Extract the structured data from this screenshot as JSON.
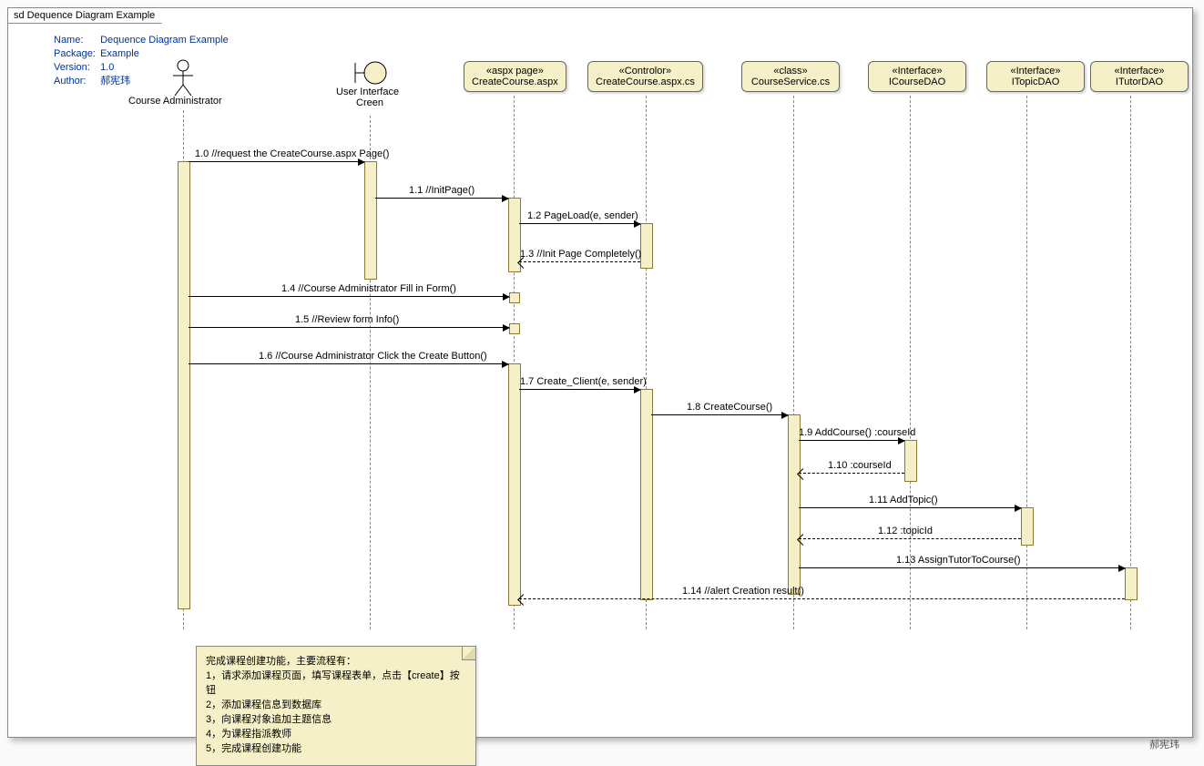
{
  "frame_label": "sd Dequence Diagram Example",
  "meta": {
    "name_label": "Name:",
    "name": "Dequence Diagram Example",
    "pkg_label": "Package:",
    "pkg": "Example",
    "ver_label": "Version:",
    "ver": "1.0",
    "auth_label": "Author:",
    "auth": "郝宪玮"
  },
  "participants": {
    "p1": "Course Administrator",
    "p2_a": "User Interface",
    "p2_b": "Creen",
    "p3_s": "«aspx page»",
    "p3": "CreateCourse.aspx",
    "p4_s": "«Controlor»",
    "p4": "CreateCourse.aspx.cs",
    "p5_s": "«class»",
    "p5": "CourseService.cs",
    "p6_s": "«Interface»",
    "p6": "ICourseDAO",
    "p7_s": "«Interface»",
    "p7": "ITopicDAO",
    "p8_s": "«Interface»",
    "p8": "ITutorDAO"
  },
  "messages": {
    "m1": "1.0 //request the CreateCourse.aspx Page()",
    "m2": "1.1 //InitPage()",
    "m3": "1.2 PageLoad(e, sender)",
    "m4": "1.3 //Init Page Completely()",
    "m5": "1.4 //Course Administrator Fill in  Form()",
    "m6": "1.5 //Review  form Info()",
    "m7": "1.6 //Course Administrator Click the Create Button()",
    "m8": "1.7 Create_Client(e, sender)",
    "m9": "1.8 CreateCourse()",
    "m10": "1.9 AddCourse() :courseId",
    "m11": "1.10  :courseId",
    "m12": "1.11 AddTopic()",
    "m13": "1.12  :topicId",
    "m14": "1.13 AssignTutorToCourse()",
    "m15": "1.14 //alert Creation result()"
  },
  "note": {
    "l1": "完成课程创建功能，主要流程有：",
    "l2": "1，请求添加课程页面，填写课程表单，点击【create】按钮",
    "l3": "2，添加课程信息到数据库",
    "l4": "3，向课程对象追加主题信息",
    "l5": "4，为课程指派教师",
    "l6": "5，完成课程创建功能"
  },
  "signature": "郝宪玮"
}
